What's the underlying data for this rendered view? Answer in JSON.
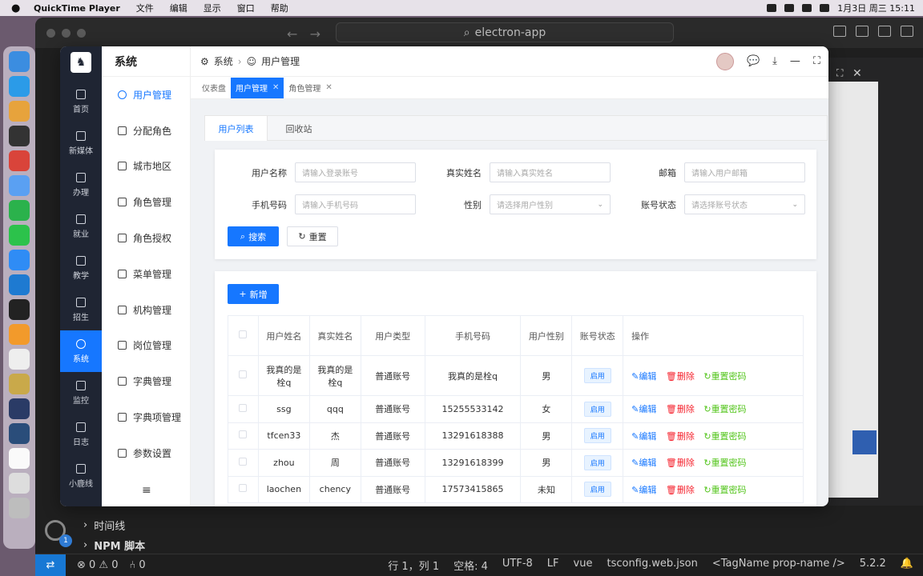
{
  "menubar": {
    "app_name": "QuickTime Player",
    "menus": [
      "文件",
      "编辑",
      "显示",
      "窗口",
      "帮助"
    ],
    "clock": "1月3日 周三  15:11"
  },
  "vscode": {
    "search_text": "electron-app",
    "tree": [
      "时间线",
      "NPM 脚本"
    ],
    "gear_badge": "1",
    "status_left": [
      "⊗ 0 ⚠ 0",
      "⑃ 0"
    ],
    "status_right": [
      "行 1，列 1",
      "空格: 4",
      "UTF-8",
      "LF",
      "vue",
      "tsconfig.web.json",
      "<TagName prop-name />",
      "5.2.2"
    ]
  },
  "rail": {
    "items": [
      "首页",
      "新媒体",
      "办理",
      "就业",
      "教学",
      "招生",
      "系统",
      "监控",
      "日志",
      "小鹿线"
    ]
  },
  "sidenav": {
    "title": "系统",
    "items": [
      "用户管理",
      "分配角色",
      "城市地区",
      "角色管理",
      "角色授权",
      "菜单管理",
      "机构管理",
      "岗位管理",
      "字典管理",
      "字典项管理",
      "参数设置"
    ]
  },
  "breadcrumb": {
    "root": "系统",
    "current": "用户管理"
  },
  "tabs": [
    "仪表盘",
    "用户管理",
    "角色管理"
  ],
  "subtabs": [
    "用户列表",
    "回收站"
  ],
  "search": {
    "username_label": "用户名称",
    "username_ph": "请输入登录账号",
    "realname_label": "真实姓名",
    "realname_ph": "请输入真实姓名",
    "email_label": "邮箱",
    "email_ph": "请输入用户邮箱",
    "phone_label": "手机号码",
    "phone_ph": "请输入手机号码",
    "gender_label": "性别",
    "gender_ph": "请选择用户性别",
    "status_label": "账号状态",
    "status_ph": "请选择账号状态",
    "search_btn": "搜索",
    "reset_btn": "重置"
  },
  "table": {
    "add_btn": "新增",
    "headers": [
      "用户姓名",
      "真实姓名",
      "用户类型",
      "手机号码",
      "用户性别",
      "账号状态",
      "操作"
    ],
    "rows": [
      {
        "name": "我真的是栓q",
        "real": "我真的是栓q",
        "type": "普通账号",
        "phone": "我真的是栓q",
        "gender": "男",
        "status": "启用"
      },
      {
        "name": "ssg",
        "real": "qqq",
        "type": "普通账号",
        "phone": "15255533142",
        "gender": "女",
        "status": "启用"
      },
      {
        "name": "tfcen33",
        "real": "杰",
        "type": "普通账号",
        "phone": "13291618388",
        "gender": "男",
        "status": "启用"
      },
      {
        "name": "zhou",
        "real": "周",
        "type": "普通账号",
        "phone": "13291618399",
        "gender": "男",
        "status": "启用"
      },
      {
        "name": "laochen",
        "real": "chency",
        "type": "普通账号",
        "phone": "17573415865",
        "gender": "未知",
        "status": "启用"
      }
    ],
    "op_edit": "编辑",
    "op_delete": "删除",
    "op_reset": "重置密码"
  }
}
